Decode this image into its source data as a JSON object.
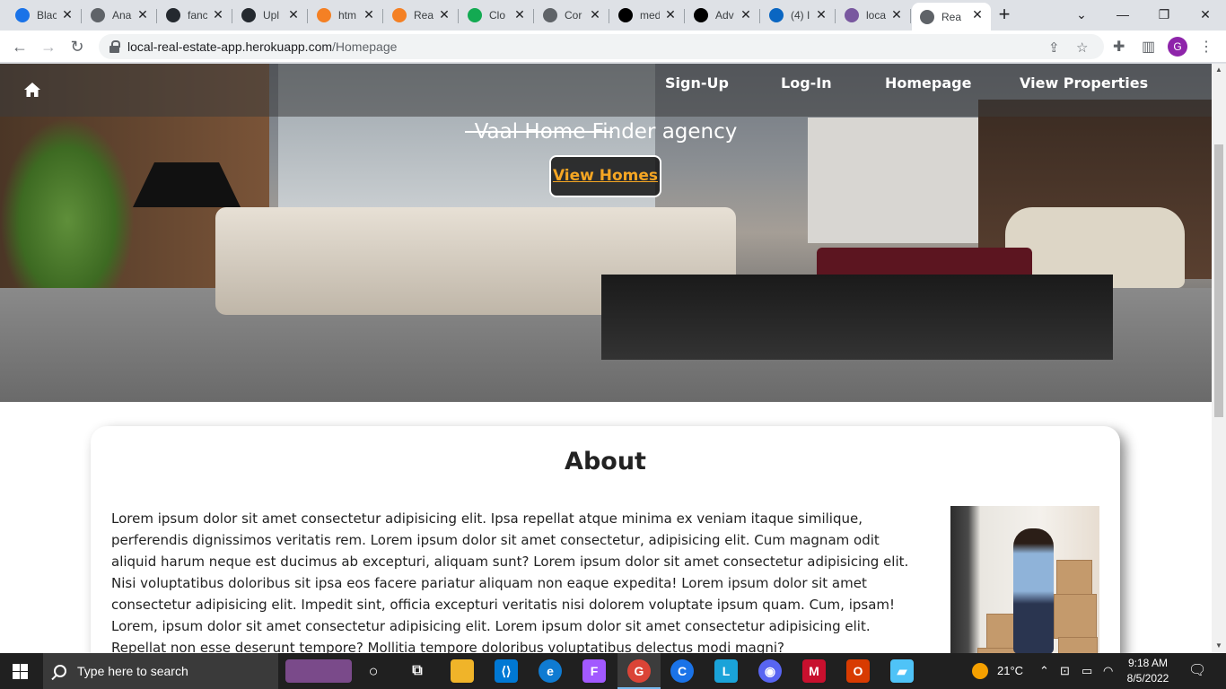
{
  "browser": {
    "tabs": [
      {
        "title": "Blac",
        "icon": "blue-c-icon",
        "color": "#1a73e8"
      },
      {
        "title": "Ana",
        "icon": "globe-icon",
        "color": "#5f6368"
      },
      {
        "title": "fanc",
        "icon": "github-icon",
        "color": "#24292f"
      },
      {
        "title": "Upl",
        "icon": "github-icon",
        "color": "#24292f"
      },
      {
        "title": "htm",
        "icon": "stackoverflow-icon",
        "color": "#f48024"
      },
      {
        "title": "Rea",
        "icon": "stackoverflow-icon",
        "color": "#f48024"
      },
      {
        "title": "Clo",
        "icon": "mongodb-icon",
        "color": "#13aa52"
      },
      {
        "title": "Cor",
        "icon": "globe-icon",
        "color": "#5f6368"
      },
      {
        "title": "med",
        "icon": "medium-icon",
        "color": "#000000"
      },
      {
        "title": "Adv",
        "icon": "medium-icon",
        "color": "#000000"
      },
      {
        "title": "(4) I",
        "icon": "linkedin-icon",
        "color": "#0a66c2"
      },
      {
        "title": "loca",
        "icon": "heroku-icon",
        "color": "#79589f"
      },
      {
        "title": "Rea",
        "icon": "globe-icon",
        "color": "#5f6368",
        "active": true
      }
    ],
    "url_host": "local-real-estate-app.herokuapp.com",
    "url_path": "/Homepage",
    "profile_initial": "G"
  },
  "site": {
    "nav": {
      "links": [
        "Sign-Up",
        "Log-In",
        "Homepage",
        "View Properties"
      ]
    },
    "hero": {
      "title": "Vaal Home Finder agency",
      "button": "View Homes"
    },
    "about": {
      "heading": "About",
      "text": "Lorem ipsum dolor sit amet consectetur adipisicing elit. Ipsa repellat atque minima ex veniam itaque similique, perferendis dignissimos veritatis rem. Lorem ipsum dolor sit amet consectetur, adipisicing elit. Cum magnam odit aliquid harum neque est ducimus ab excepturi, aliquam sunt? Lorem ipsum dolor sit amet consectetur adipisicing elit. Nisi voluptatibus doloribus sit ipsa eos facere pariatur aliquam non eaque expedita! Lorem ipsum dolor sit amet consectetur adipisicing elit. Impedit sint, officia excepturi veritatis nisi dolorem voluptate ipsum quam. Cum, ipsam! Lorem, ipsum dolor sit amet consectetur adipisicing elit. Lorem ipsum dolor sit amet consectetur adipisicing elit. Repellat non esse deserunt tempore? Mollitia tempore doloribus voluptatibus delectus modi magni?"
    },
    "accent_color": "#f5a623"
  },
  "taskbar": {
    "search_placeholder": "Type here to search",
    "weather": "21°C",
    "time": "9:18 AM",
    "date": "8/5/2022"
  }
}
